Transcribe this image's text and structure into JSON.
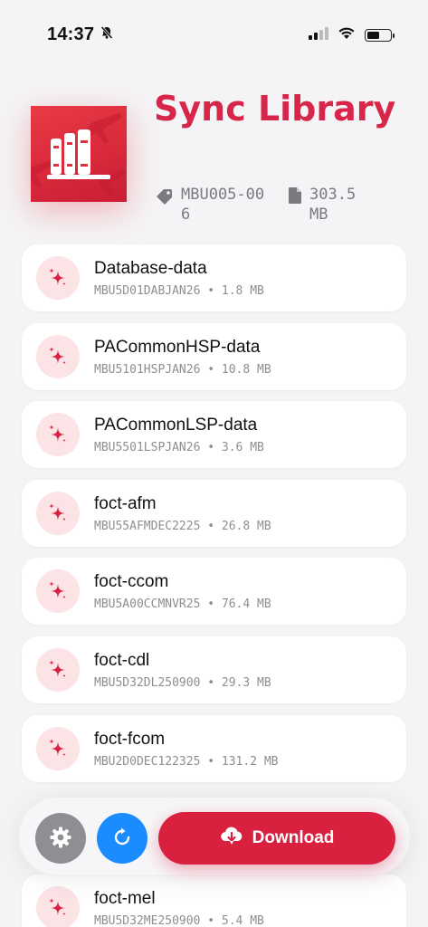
{
  "status_bar": {
    "time": "14:37"
  },
  "header": {
    "title": "Sync Library",
    "tag": "MBU005-006",
    "size": "303.5 MB"
  },
  "items": [
    {
      "name": "Database-data",
      "id": "MBU5D01DABJAN26",
      "size": "1.8 MB"
    },
    {
      "name": "PACommonHSP-data",
      "id": "MBU5101HSPJAN26",
      "size": "10.8 MB"
    },
    {
      "name": "PACommonLSP-data",
      "id": "MBU5501LSPJAN26",
      "size": "3.6 MB"
    },
    {
      "name": "foct-afm",
      "id": "MBU55AFMDEC2225",
      "size": "26.8 MB"
    },
    {
      "name": "foct-ccom",
      "id": "MBU5A00CCMNVR25",
      "size": "76.4 MB"
    },
    {
      "name": "foct-cdl",
      "id": "MBU5D32DL250900",
      "size": "29.3 MB"
    },
    {
      "name": "foct-fcom",
      "id": "MBU2D0DEC122325",
      "size": "131.2 MB"
    },
    {
      "name": "foct-mel",
      "id": "MBU5D32ME250900",
      "size": "5.4 MB"
    }
  ],
  "actions": {
    "download_label": "Download"
  },
  "icons": {
    "status_bell": "bell-slash-icon",
    "signal": "cellular-signal-icon",
    "wifi": "wifi-icon",
    "battery": "battery-icon",
    "tag": "tag-icon",
    "file": "file-icon",
    "item": "sparkles-icon",
    "settings": "gear-icon",
    "refresh": "refresh-icon",
    "download": "cloud-download-icon"
  },
  "colors": {
    "accent": "#d9203f",
    "title": "#d8264a",
    "refresh": "#1a8cff",
    "settings": "#8e8e93",
    "icon_bg": "#fbe3e6"
  }
}
